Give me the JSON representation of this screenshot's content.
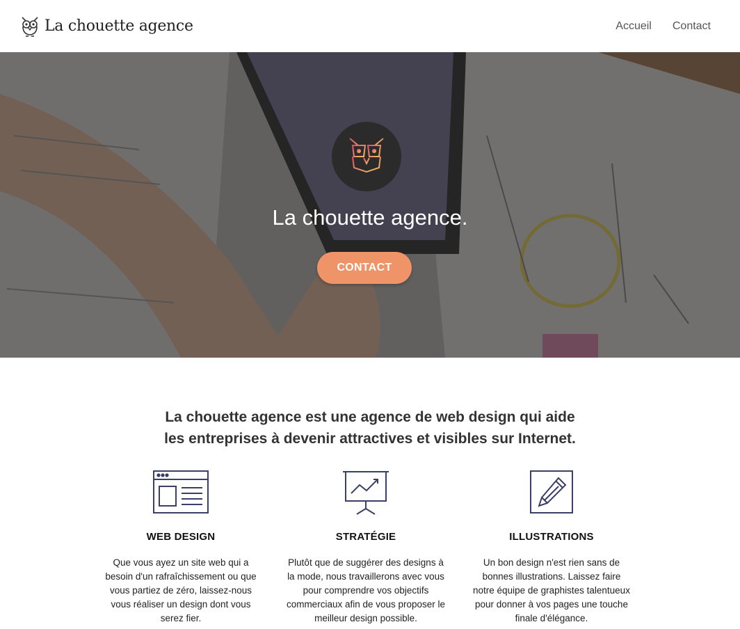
{
  "header": {
    "brand_name": "La chouette agence",
    "nav": [
      {
        "label": "Accueil"
      },
      {
        "label": "Contact"
      }
    ]
  },
  "hero": {
    "title": "La chouette agence.",
    "cta_label": "CONTACT"
  },
  "intro": {
    "line1": "La chouette agence est une agence de web design qui aide",
    "line2": "les entreprises à devenir attractives et visibles sur Internet."
  },
  "services": [
    {
      "icon": "web-layout-icon",
      "title": "WEB DESIGN",
      "lines": [
        "Que vous ayez un site web qui a",
        "besoin d'un rafraîchissement ou que",
        "vous partiez de zéro, laissez-nous",
        "vous réaliser un design dont vous",
        "serez fier."
      ]
    },
    {
      "icon": "presentation-chart-icon",
      "title": "STRATÉGIE",
      "lines": [
        "Plutôt que de suggérer des designs à",
        "la mode, nous travaillerons avec vous",
        "pour comprendre vos objectifs",
        "commerciaux afin de vous proposer le",
        "meilleur design possible."
      ]
    },
    {
      "icon": "pencil-icon",
      "title": "ILLUSTRATIONS",
      "lines": [
        "Un bon design n'est rien sans de",
        "bonnes illustrations. Laissez faire",
        "notre équipe de graphistes talentueux",
        "pour donner à vos pages une touche",
        "finale d'élégance."
      ]
    }
  ],
  "colors": {
    "accent": "#ee9468",
    "icon_stroke": "#3a3f66",
    "text": "#333333"
  }
}
